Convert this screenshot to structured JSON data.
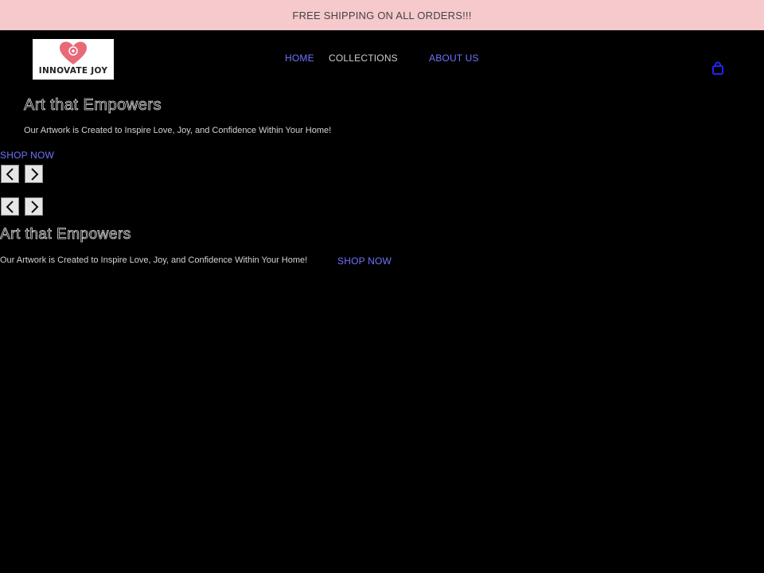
{
  "announcement": "FREE SHIPPING ON ALL ORDERS!!!",
  "logo": {
    "text": "INNOVATE JOY",
    "icon": "heart-icon",
    "accent": "#e86a77"
  },
  "nav": {
    "home": "HOME",
    "collections": "COLLECTIONS",
    "about": "ABOUT US"
  },
  "cart": {
    "icon": "shopping-bag-icon",
    "color": "#2222ff"
  },
  "hero": {
    "title": "Art that Empowers",
    "subtitle": "Our Artwork is Created to Inspire Love, Joy, and Confidence Within Your Home!",
    "cta": "SHOP NOW"
  },
  "slide2": {
    "title": "Art that Empowers",
    "subtitle": "Our Artwork is Created to Inspire Love, Joy, and Confidence Within Your Home!",
    "cta": "SHOP NOW"
  },
  "controls": {
    "prev_icon": "chevron-left-icon",
    "next_icon": "chevron-right-icon"
  },
  "colors": {
    "banner": "#f6c9cc",
    "link": "#6f73ff",
    "background": "#000000"
  }
}
